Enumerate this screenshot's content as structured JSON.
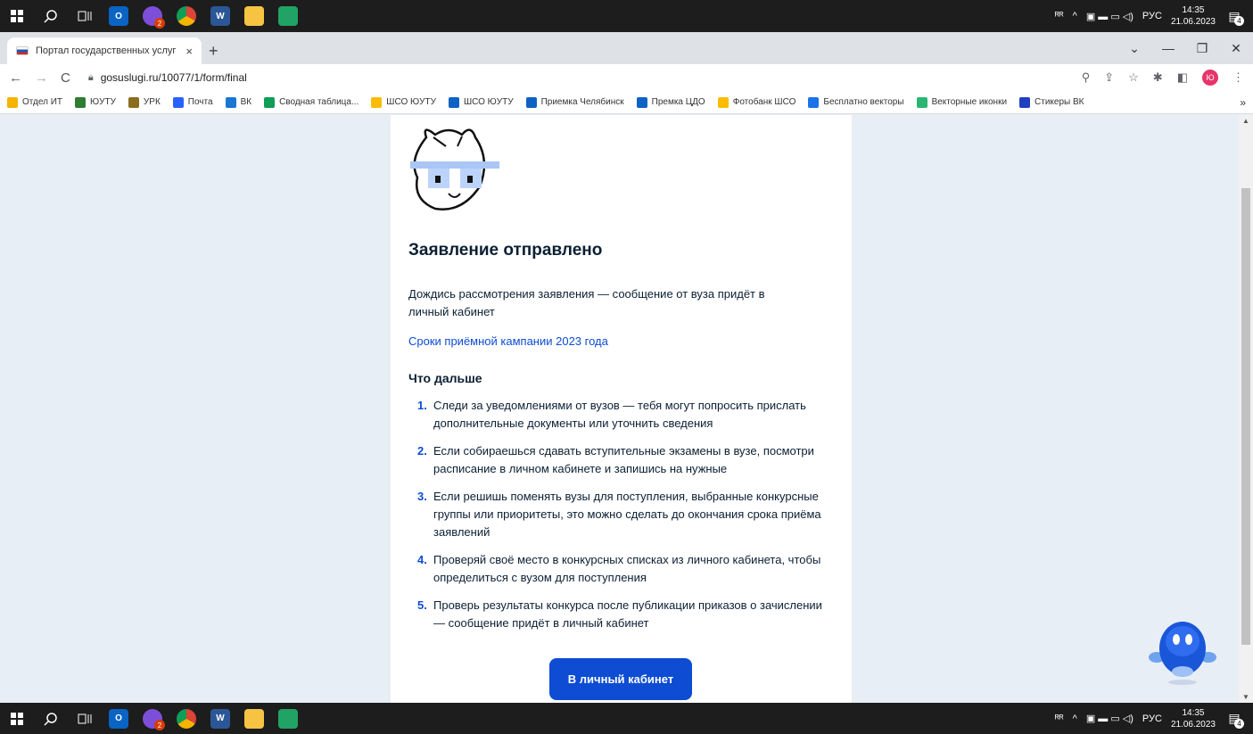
{
  "taskbar": {
    "apps": [
      {
        "name": "start",
        "label": ""
      },
      {
        "name": "search",
        "label": ""
      },
      {
        "name": "taskview",
        "label": ""
      },
      {
        "name": "outlook",
        "label": "O"
      },
      {
        "name": "viber",
        "label": "",
        "badge": "2"
      },
      {
        "name": "chrome",
        "label": ""
      },
      {
        "name": "word",
        "label": "W"
      },
      {
        "name": "explorer",
        "label": ""
      },
      {
        "name": "app",
        "label": ""
      }
    ],
    "lang": "РУС",
    "time": "14:35",
    "date": "21.06.2023",
    "notifications": "4"
  },
  "browser": {
    "tab_title": "Портал государственных услуг",
    "tab_close": "×",
    "new_tab": "+",
    "url": "gosuslugi.ru/10077/1/form/final",
    "profile_initials": "Ю"
  },
  "bookmarks": [
    {
      "label": "Отдел ИТ",
      "color": "#f4b400"
    },
    {
      "label": "ЮУТУ",
      "color": "#2e7d32"
    },
    {
      "label": "УРК",
      "color": "#8b6d1f"
    },
    {
      "label": "Почта",
      "color": "#2962ff"
    },
    {
      "label": "ВК",
      "color": "#1976d2"
    },
    {
      "label": "Сводная таблица...",
      "color": "#0f9d58"
    },
    {
      "label": "ШСО ЮУТУ",
      "color": "#fbbc04"
    },
    {
      "label": "ШСО ЮУТУ",
      "color": "#0f62c4"
    },
    {
      "label": "Приемка Челябинск",
      "color": "#0f62c4"
    },
    {
      "label": "Премка ЦДО",
      "color": "#0f62c4"
    },
    {
      "label": "Фотобанк ШСО",
      "color": "#fbbc04"
    },
    {
      "label": "Бесплатно векторы",
      "color": "#1a73e8"
    },
    {
      "label": "Векторные иконки",
      "color": "#2bb673"
    },
    {
      "label": "Стикеры ВК",
      "color": "#1f3fbf"
    }
  ],
  "bookmarks_more": "»",
  "page": {
    "title": "Заявление отправлено",
    "description": "Дождись рассмотрения заявления — сообщение от вуза придёт в личный кабинет",
    "link": "Сроки приёмной кампании 2023 года",
    "next_title": "Что дальше",
    "steps": [
      {
        "num": "1.",
        "text": "Следи за уведомлениями от вузов — тебя могут попросить прислать дополнительные документы или уточнить сведения"
      },
      {
        "num": "2.",
        "text": "Если собираешься сдавать вступительные экзамены в вузе, посмотри расписание в личном кабинете и запишись на нужные"
      },
      {
        "num": "3.",
        "text": "Если решишь поменять вузы для поступления, выбранные конкурсные группы или приоритеты, это можно сделать до окончания срока приёма заявлений"
      },
      {
        "num": "4.",
        "text": "Проверяй своё место в конкурсных списках из личного кабинета, чтобы определиться с вузом для поступления"
      },
      {
        "num": "5.",
        "text": "Проверь результаты конкурса после публикации приказов о зачислении — сообщение придёт в личный кабинет"
      }
    ],
    "button": "В личный кабинет"
  }
}
